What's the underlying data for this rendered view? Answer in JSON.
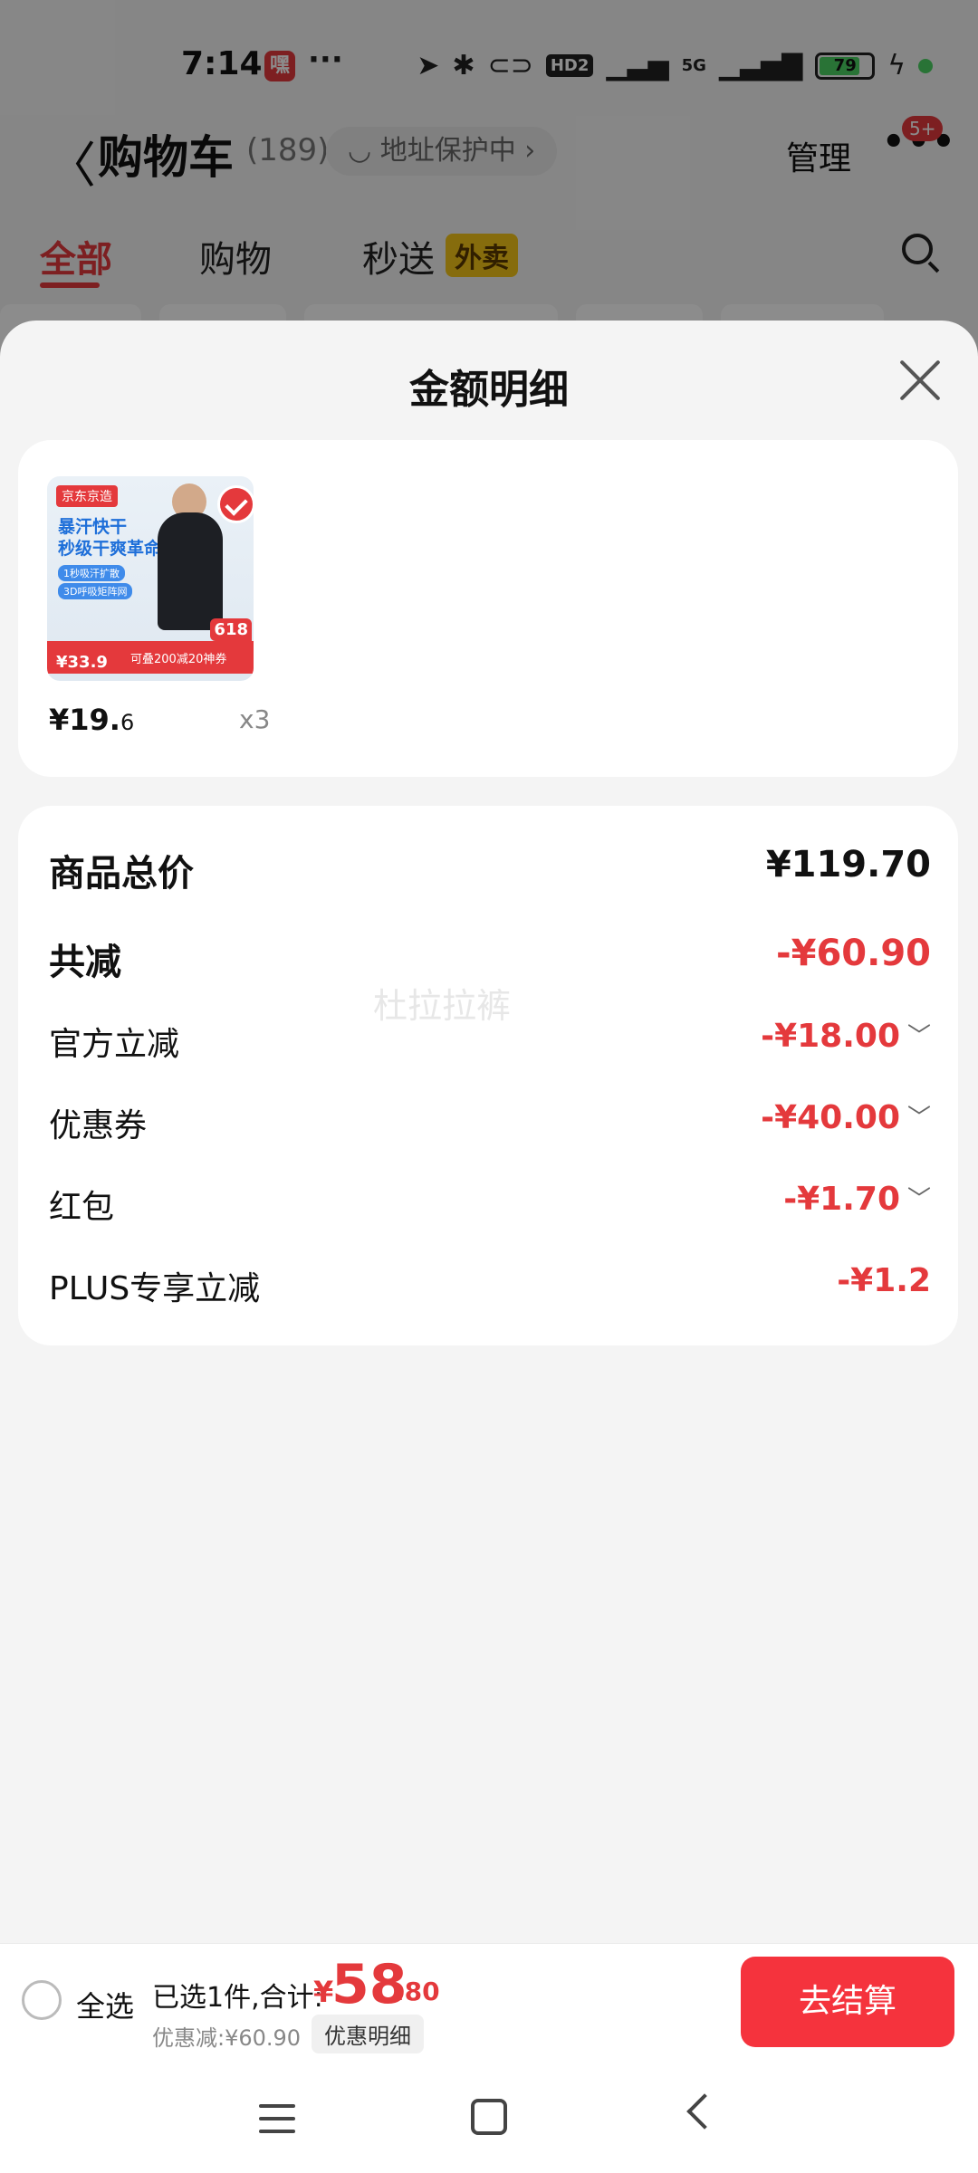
{
  "status_bar": {
    "time": "7:14",
    "app_badge_text": "嘿",
    "more_dots": "···",
    "hd_label": "HD2",
    "network_label": "5G",
    "battery": "79"
  },
  "header": {
    "title": "购物车",
    "count": "(189)",
    "address_chip": "地址保护中",
    "manage_label": "管理",
    "more_label": "•••",
    "message_badge": "5+"
  },
  "tabs": [
    {
      "label": "全部",
      "active": true
    },
    {
      "label": "购物",
      "active": false
    },
    {
      "label": "秒送",
      "active": false,
      "tag": "外卖"
    }
  ],
  "sheet": {
    "title": "金额明细",
    "product": {
      "thumb_brand": "京东京造",
      "thumb_headline": "暴汗快干\n秒级干爽革命",
      "thumb_pill1": "1秒吸汗扩散",
      "thumb_pill2": "3D呼吸矩阵网",
      "thumb_price": "¥33.9",
      "thumb_coupon": "可叠200减20神券",
      "thumb_tag": "618",
      "price_main": "¥19.",
      "price_decimal": "6",
      "quantity": "x3"
    },
    "watermark": "杜拉拉裤",
    "rows": [
      {
        "label": "商品总价",
        "value": "¥119.70"
      },
      {
        "label": "共减",
        "value": "-¥60.90"
      },
      {
        "label": "官方立减",
        "value": "-¥18.00",
        "chevron": "﹀"
      },
      {
        "label": "优惠券",
        "value": "-¥40.00",
        "chevron": "﹀"
      },
      {
        "label": "红包",
        "value": "-¥1.70",
        "chevron": "﹀"
      },
      {
        "label": "PLUS专享立减",
        "value": "-¥1.2"
      }
    ]
  },
  "bottom_bar": {
    "select_all": "全选",
    "selected_text": "已选1件,合计:",
    "currency": "¥",
    "total_int": "58",
    "total_dec": ".80",
    "discount_text": "优惠减:¥60.90",
    "detail_chip": "优惠明细",
    "checkout_label": "去结算"
  },
  "colors": {
    "accent": "#e4393c",
    "checkout": "#f5333d",
    "sheet_bg": "#f4f4f4"
  }
}
